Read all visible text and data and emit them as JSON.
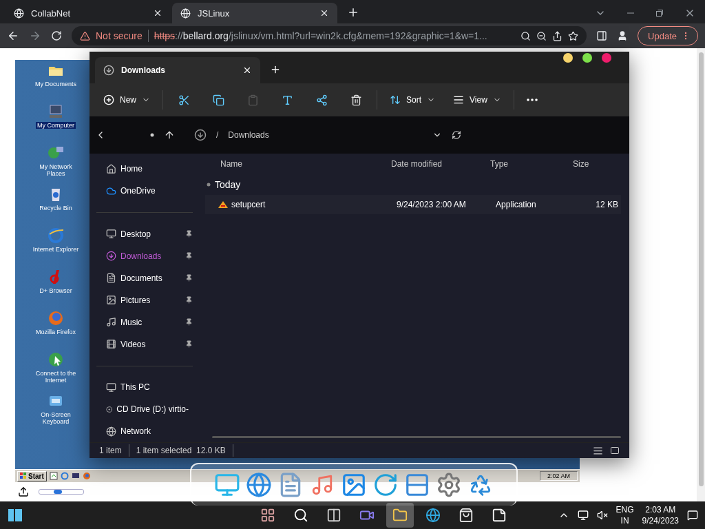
{
  "browser": {
    "tabs": [
      {
        "title": "CollabNet",
        "selected": false
      },
      {
        "title": "JSLinux",
        "selected": true
      }
    ],
    "address": {
      "security": "Not secure",
      "scheme": "https",
      "separator": "://",
      "host": "bellard.org",
      "path": "/jslinux/vm.html?url=win2k.cfg&mem=192&graphic=1&w=1..."
    },
    "update_button": "Update"
  },
  "desktop": {
    "icons": [
      {
        "label": "My Documents",
        "kind": "folder",
        "selected": false
      },
      {
        "label": "My Computer",
        "kind": "computer",
        "selected": true
      },
      {
        "label": "My Network Places",
        "kind": "network",
        "selected": false
      },
      {
        "label": "Recycle Bin",
        "kind": "bin",
        "selected": false
      },
      {
        "label": "Internet Explorer",
        "kind": "ie",
        "selected": false
      },
      {
        "label": "D+ Browser",
        "kind": "dplus",
        "selected": false
      },
      {
        "label": "Mozilla Firefox",
        "kind": "firefox",
        "selected": false
      },
      {
        "label": "Connect to the Internet",
        "kind": "connect",
        "selected": false
      },
      {
        "label": "On-Screen Keyboard",
        "kind": "keyboard",
        "selected": false
      }
    ],
    "taskbar": {
      "start": "Start",
      "clock": "2:02 AM"
    },
    "slider": {
      "level": 0.4
    }
  },
  "explorer": {
    "tab": "Downloads",
    "toolbar": {
      "new": "New",
      "sort": "Sort",
      "view": "View"
    },
    "breadcrumb_separator": "/",
    "breadcrumb": "Downloads",
    "sidebar": [
      [
        {
          "label": "Home",
          "pinned": false,
          "selected": false
        },
        {
          "label": "OneDrive",
          "pinned": false,
          "selected": false
        }
      ],
      [
        {
          "label": "Desktop",
          "pinned": true,
          "selected": false
        },
        {
          "label": "Downloads",
          "pinned": true,
          "selected": true
        },
        {
          "label": "Documents",
          "pinned": true,
          "selected": false
        },
        {
          "label": "Pictures",
          "pinned": true,
          "selected": false
        },
        {
          "label": "Music",
          "pinned": true,
          "selected": false
        },
        {
          "label": "Videos",
          "pinned": true,
          "selected": false
        }
      ],
      [
        {
          "label": "This PC",
          "pinned": false,
          "selected": false
        },
        {
          "label": "CD Drive (D:) virtio-",
          "pinned": false,
          "selected": false
        },
        {
          "label": "Network",
          "pinned": false,
          "selected": false
        }
      ]
    ],
    "columns": [
      "Name",
      "Date modified",
      "Type",
      "Size"
    ],
    "group": "Today",
    "rows": [
      {
        "name": "setupcert",
        "date": "9/24/2023 2:00 AM",
        "type": "Application",
        "size": "12 KB"
      }
    ],
    "status": {
      "count": "1 item",
      "selection": "1 item selected",
      "size": "12.0 KB"
    }
  },
  "taskbar": {
    "apps": [
      {
        "kind": "widgets",
        "selected": false
      },
      {
        "kind": "search",
        "selected": false
      },
      {
        "kind": "taskview",
        "selected": false
      },
      {
        "kind": "chat",
        "selected": false
      },
      {
        "kind": "explorer",
        "selected": true
      },
      {
        "kind": "edge",
        "selected": false
      },
      {
        "kind": "store",
        "selected": false
      },
      {
        "kind": "notes",
        "selected": false
      }
    ],
    "language": "ENG",
    "region": "IN",
    "time": "2:03 AM",
    "date": "9/24/2023"
  }
}
